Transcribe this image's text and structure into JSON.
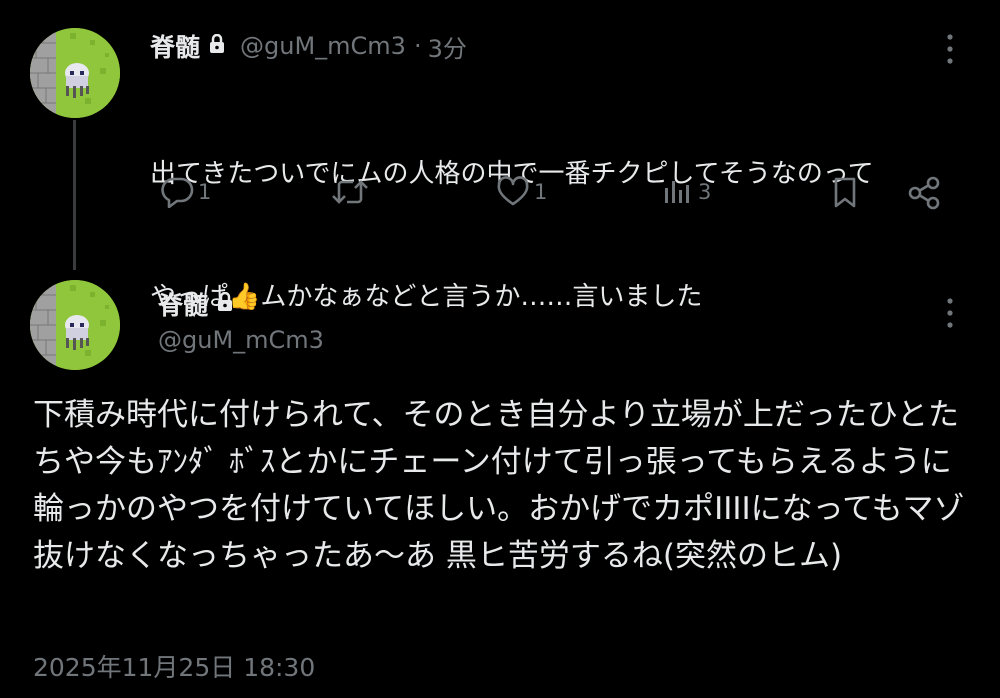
{
  "reply_parent": {
    "display_name": "脊髄",
    "handle": "@guM_mCm3",
    "separator": "·",
    "time_ago": "3分",
    "text_line1": "出てきたついでにムの人格の中で一番チクピしてそうなのって",
    "text_line2_pre": "やっぱ",
    "text_emoji": "👍",
    "text_line2_post": "ムかなぁなどと言うか……言いました",
    "actions": {
      "reply_count": "1",
      "retweet_count": "",
      "like_count": "1",
      "view_count": "3"
    }
  },
  "main_tweet": {
    "display_name": "脊髄",
    "handle": "@guM_mCm3",
    "text": "下積み時代に付けられて、そのとき自分より立場が上だったひとたちや今もｱﾝﾀﾞ ﾎﾞｽとかにチェーン付けて引っ張ってもらえるように輪っかのやつを付けていてほしい。おかげでカポIIIIになってもマゾ抜けなくなっちゃったあ〜あ 黒ヒ苦労するね(突然のヒム)",
    "timestamp": "2025年11月25日 18:30"
  },
  "icons": {
    "lock": "lock-icon",
    "more": "more-vertical-icon",
    "reply": "reply-icon",
    "retweet": "retweet-icon",
    "like": "heart-icon",
    "views": "views-icon",
    "bookmark": "bookmark-icon",
    "share": "share-icon"
  },
  "colors": {
    "background": "#000000",
    "text": "#e7e9ea",
    "secondary": "#71767b",
    "avatar_green": "#8fc63b"
  }
}
